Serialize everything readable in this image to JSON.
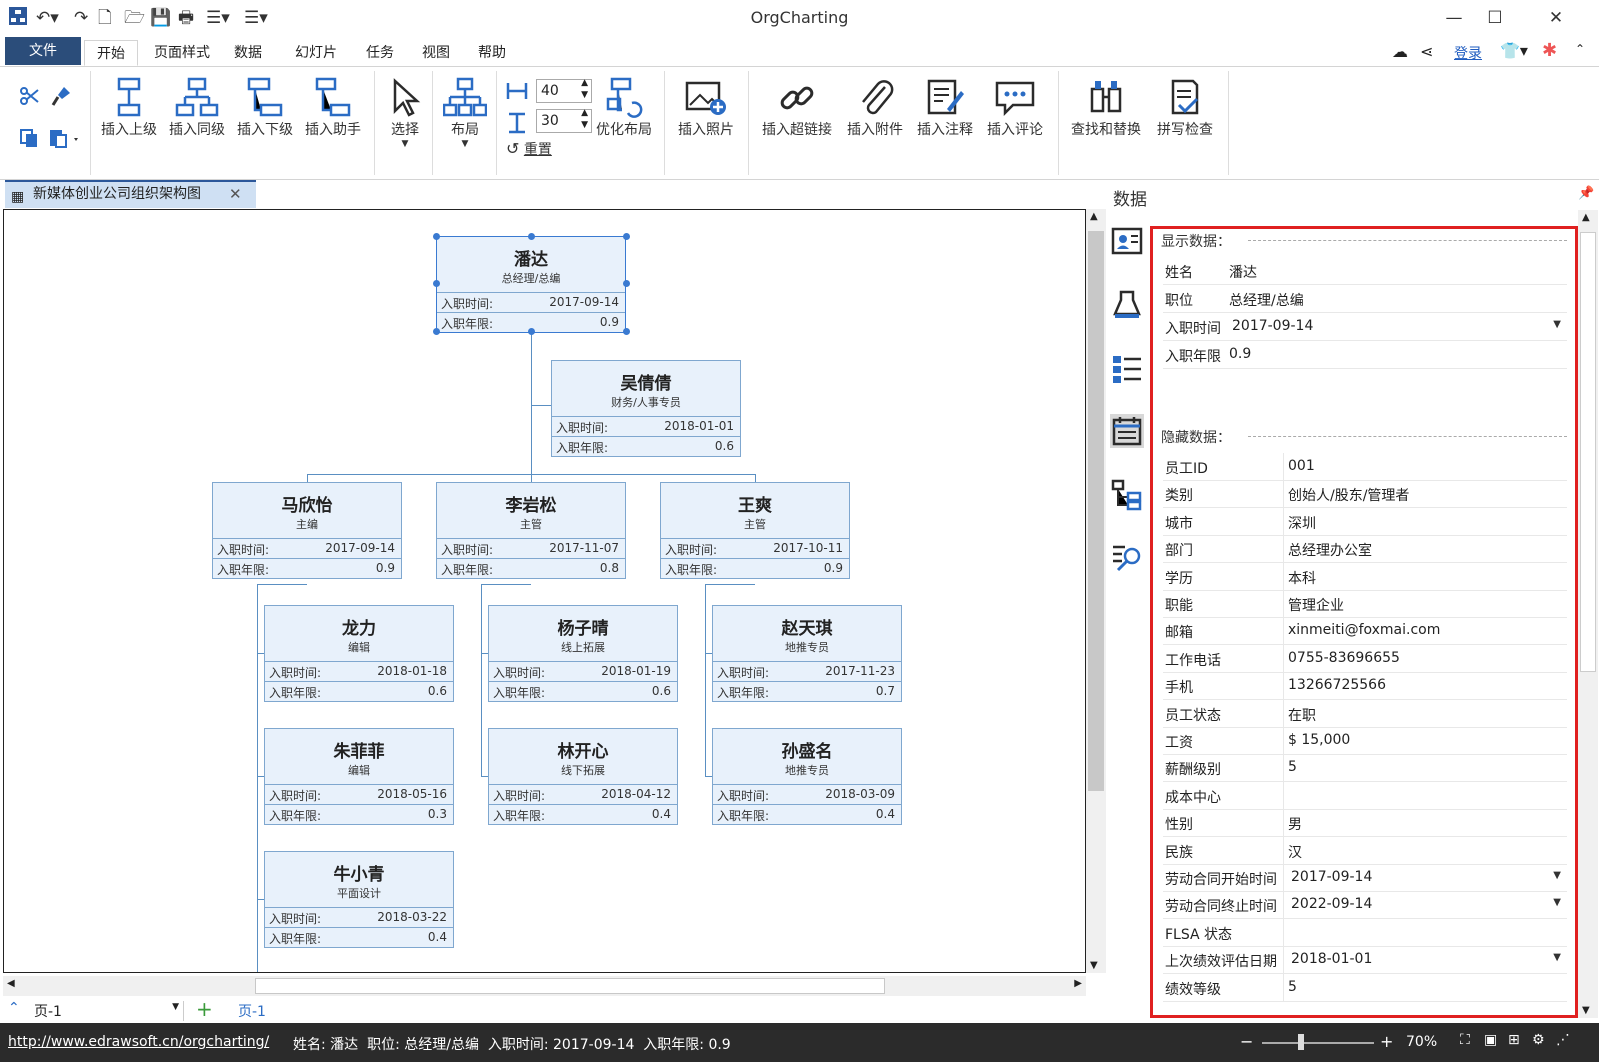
{
  "app": {
    "title": "OrgCharting"
  },
  "window": {
    "minimize": "—",
    "maximize": "☐",
    "close": "✕"
  },
  "menu": {
    "file": "文件",
    "tabs": [
      "开始",
      "页面样式",
      "数据",
      "幻灯片",
      "任务",
      "视图",
      "帮助"
    ],
    "login": "登录"
  },
  "ribbon": {
    "insert_superior": "插入上级",
    "insert_sibling": "插入同级",
    "insert_subordinate": "插入下级",
    "insert_assistant": "插入助手",
    "select": "选择",
    "layout": "布局",
    "spacing_h": "40",
    "spacing_v": "30",
    "reset": "重置",
    "optimize_layout": "优化布局",
    "insert_photo": "插入照片",
    "insert_hyperlink": "插入超链接",
    "insert_attachment": "插入附件",
    "insert_note": "插入注释",
    "insert_comment": "插入评论",
    "find_replace": "查找和替换",
    "spell_check": "拼写检查"
  },
  "document": {
    "tab_title": "新媒体创业公司组织架构图"
  },
  "field_labels": {
    "hire_date": "入职时间:",
    "tenure": "入职年限:"
  },
  "nodes": [
    {
      "name": "潘达",
      "position": "总经理/总编",
      "hire_date": "2017-09-14",
      "tenure": "0.9"
    },
    {
      "name": "吴倩倩",
      "position": "财务/人事专员",
      "hire_date": "2018-01-01",
      "tenure": "0.6"
    },
    {
      "name": "马欣怡",
      "position": "主编",
      "hire_date": "2017-09-14",
      "tenure": "0.9"
    },
    {
      "name": "李岩松",
      "position": "主管",
      "hire_date": "2017-11-07",
      "tenure": "0.8"
    },
    {
      "name": "王爽",
      "position": "主管",
      "hire_date": "2017-10-11",
      "tenure": "0.9"
    },
    {
      "name": "龙力",
      "position": "编辑",
      "hire_date": "2018-01-18",
      "tenure": "0.6"
    },
    {
      "name": "杨子晴",
      "position": "线上拓展",
      "hire_date": "2018-01-19",
      "tenure": "0.6"
    },
    {
      "name": "赵天琪",
      "position": "地推专员",
      "hire_date": "2017-11-23",
      "tenure": "0.7"
    },
    {
      "name": "朱菲菲",
      "position": "编辑",
      "hire_date": "2018-05-16",
      "tenure": "0.3"
    },
    {
      "name": "林开心",
      "position": "线下拓展",
      "hire_date": "2018-04-12",
      "tenure": "0.4"
    },
    {
      "name": "孙盛名",
      "position": "地推专员",
      "hire_date": "2018-03-09",
      "tenure": "0.4"
    },
    {
      "name": "牛小青",
      "position": "平面设计",
      "hire_date": "2018-03-22",
      "tenure": "0.4"
    }
  ],
  "pages": {
    "selector": "页-1",
    "add": "+",
    "active_tab": "页-1"
  },
  "data_panel": {
    "title": "数据",
    "shown_section": "显示数据：",
    "hidden_section": "隐藏数据：",
    "shown": [
      {
        "label": "姓名",
        "value": "潘达"
      },
      {
        "label": "职位",
        "value": "总经理/总编"
      },
      {
        "label": "入职时间",
        "value": "2017-09-14"
      },
      {
        "label": "入职年限",
        "value": "0.9"
      }
    ],
    "hidden": [
      {
        "label": "员工ID",
        "value": "001"
      },
      {
        "label": "类别",
        "value": "创始人/股东/管理者"
      },
      {
        "label": "城市",
        "value": "深圳"
      },
      {
        "label": "部门",
        "value": "总经理办公室"
      },
      {
        "label": "学历",
        "value": "本科"
      },
      {
        "label": "职能",
        "value": "管理企业"
      },
      {
        "label": "邮箱",
        "value": "xinmeiti@foxmai.com"
      },
      {
        "label": "工作电话",
        "value": "0755-83696655"
      },
      {
        "label": "手机",
        "value": "13266725566"
      },
      {
        "label": "员工状态",
        "value": "在职"
      },
      {
        "label": "工资",
        "value": "$ 15,000"
      },
      {
        "label": "薪酬级别",
        "value": "5"
      },
      {
        "label": "成本中心",
        "value": ""
      },
      {
        "label": "性别",
        "value": "男"
      },
      {
        "label": "民族",
        "value": "汉"
      },
      {
        "label": "劳动合同开始时间",
        "value": "2017-09-14"
      },
      {
        "label": "劳动合同终止时间",
        "value": "2022-09-14"
      },
      {
        "label": "FLSA 状态",
        "value": ""
      },
      {
        "label": "上次绩效评估日期",
        "value": "2018-01-01"
      },
      {
        "label": "绩效等级",
        "value": "5"
      }
    ]
  },
  "status": {
    "url": "http://www.edrawsoft.cn/orgcharting/",
    "info": "姓名: 潘达  职位: 总经理/总编  入职时间: 2017-09-14  入职年限: 0.9",
    "zoom": "70%",
    "zoom_level": 0.7
  },
  "colors": {
    "accent": "#2b579a",
    "node_fill": "#e8f1fb",
    "node_border": "#7fa7cf",
    "highlight": "#e02020"
  }
}
